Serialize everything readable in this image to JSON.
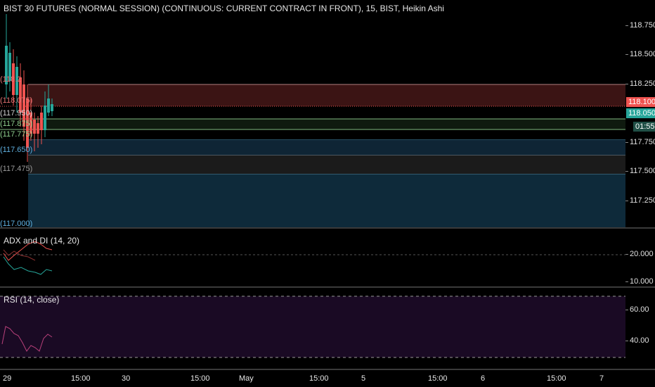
{
  "chart": {
    "title": "BIST 30 FUTURES (NORMAL SESSION) (CONTINUOUS: CURRENT CONTRACT IN FRONT), 15, BIST, Heikin Ashi",
    "price_ticks": [
      "118.750",
      "118.500",
      "118.250",
      "117.750",
      "117.500",
      "117.250"
    ],
    "current_price_badge": "118.100",
    "last_price_badge": "118.050",
    "countdown_badge": "01:55",
    "level_labels": [
      "(118.2",
      "(118.075)",
      "(117.950)",
      "(117.875)",
      "(117.775)",
      "(117.650)",
      "(117.475)",
      "(117.000)"
    ],
    "colors": {
      "up": "#26a69a",
      "down": "#ef5350",
      "zone_red": "#3b1414",
      "zone_dark": "#1e1e1e",
      "zone_blue": "#0e2a3a",
      "badge_red": "#ef5350",
      "badge_green": "#26a69a",
      "badge_dark": "#1f4f46"
    }
  },
  "adx_panel": {
    "title": "ADX and DI (14, 20)",
    "ticks": [
      "20.000",
      "10.000"
    ]
  },
  "rsi_panel": {
    "title": "RSI (14, close)",
    "ticks": [
      "60.00",
      "40.00"
    ],
    "fill_color": "#1a0a24"
  },
  "time_axis": {
    "labels": [
      "29",
      "15:00",
      "30",
      "15:00",
      "May",
      "15:00",
      "5",
      "15:00",
      "6",
      "15:00",
      "7"
    ]
  }
}
